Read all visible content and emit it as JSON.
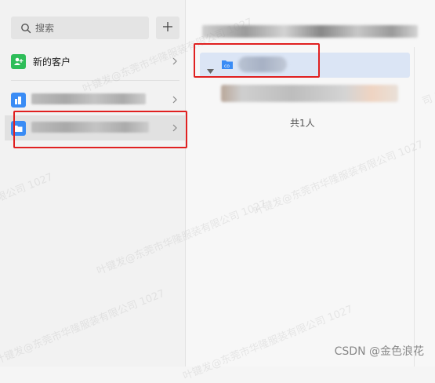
{
  "search": {
    "placeholder": "搜索"
  },
  "sidebar": {
    "items": [
      {
        "label": "新的客户"
      }
    ]
  },
  "main": {
    "member_count": "共1人"
  },
  "watermark": {
    "text_1": "叶键发@东莞市华隆服装有限公司 1027",
    "text_2": "有限公司 1027",
    "text_3": "司 1027"
  },
  "footer": {
    "credit": "CSDN @金色浪花"
  },
  "colors": {
    "accent_blue": "#3a8cf5",
    "accent_green": "#2ebd59",
    "selection_highlight": "#dbe5f5",
    "annotation_red": "#e02020"
  }
}
